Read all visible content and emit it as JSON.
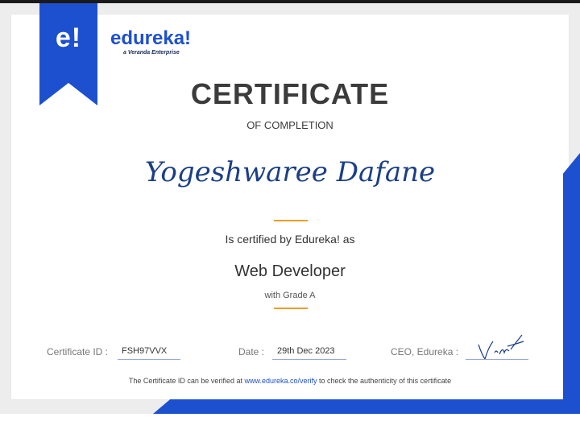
{
  "brand": {
    "mark": "e!",
    "name": "edureka!",
    "tagline": "a Veranda Enterprise"
  },
  "certificate": {
    "title": "CERTIFICATE",
    "subtitle": "OF COMPLETION",
    "recipient": "Yogeshwaree Dafane",
    "certified_by": "Is certified by Edureka! as",
    "course": "Web Developer",
    "grade": "with Grade A"
  },
  "fields": {
    "id_label": "Certificate ID :",
    "id_value": "FSH97VVX",
    "date_label": "Date :",
    "date_value": "29th Dec 2023",
    "ceo_label": "CEO, Edureka :"
  },
  "footnote": {
    "prefix": "The Certificate ID can be verified at ",
    "link": "www.edureka.co/verify",
    "suffix": " to check the authenticity of this certificate"
  },
  "colors": {
    "accent": "#1d50cf",
    "divider": "#f29b24",
    "recipient": "#1b3f86"
  }
}
